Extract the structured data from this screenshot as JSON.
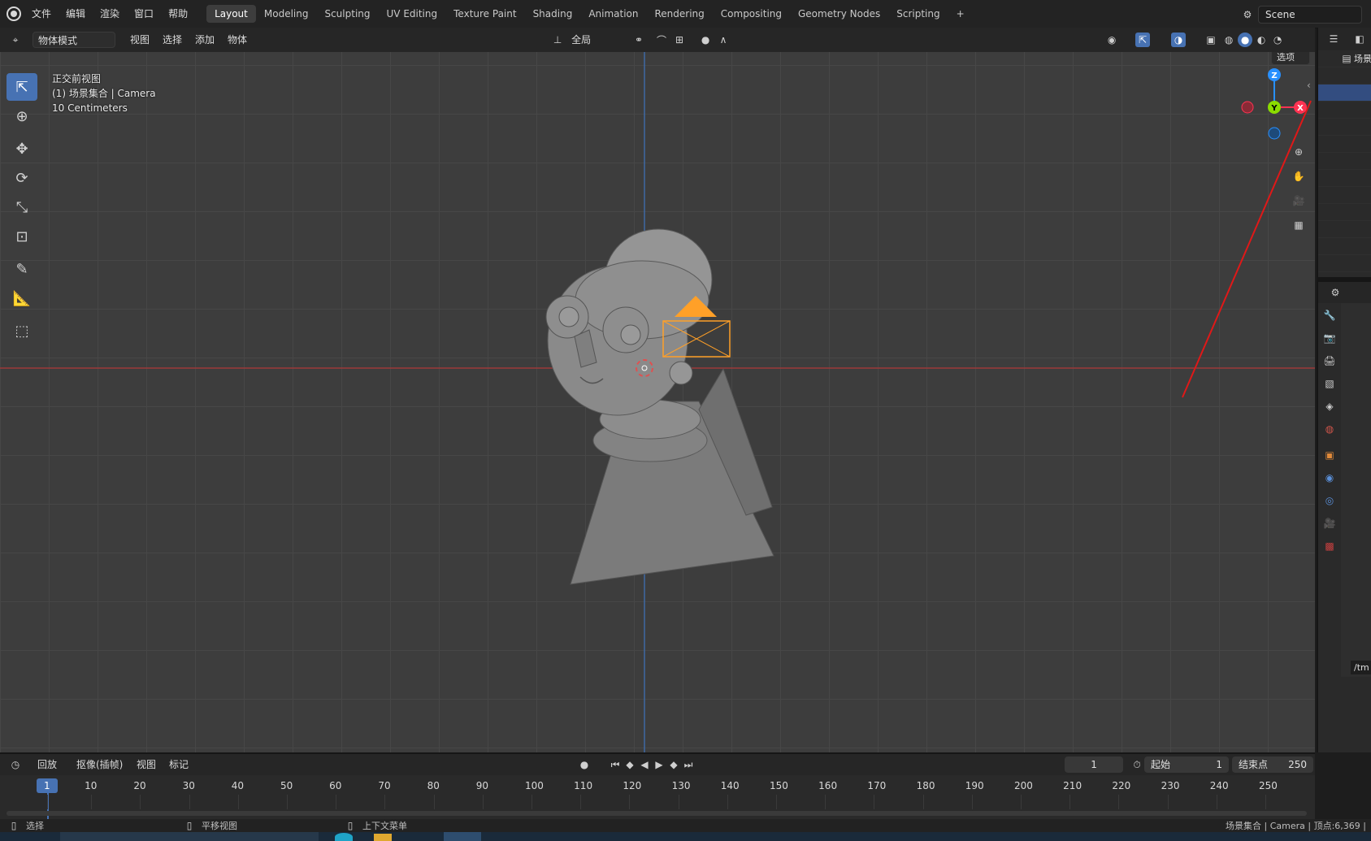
{
  "menubar": {
    "items": [
      "文件",
      "编辑",
      "渲染",
      "窗口",
      "帮助"
    ],
    "workspaces": [
      "Layout",
      "Modeling",
      "Sculpting",
      "UV Editing",
      "Texture Paint",
      "Shading",
      "Animation",
      "Rendering",
      "Compositing",
      "Geometry Nodes",
      "Scripting"
    ],
    "active_workspace": "Layout",
    "add_tab": "+",
    "scene_name": "Scene"
  },
  "viewport_header": {
    "mode": "物体模式",
    "menus": [
      "视图",
      "选择",
      "添加",
      "物体"
    ],
    "transform_orientation": "全局",
    "options": "选项"
  },
  "viewport": {
    "view_name": "正交前视图",
    "collection_info": "(1) 场景集合 | Camera",
    "scale_info": "10 Centimeters",
    "gizmo_axes": {
      "z": "Z",
      "y": "Y",
      "x": "X"
    }
  },
  "outliner": {
    "header_label": "场景"
  },
  "timeline": {
    "menus": [
      "回放",
      "抠像(插帧)",
      "视图",
      "标记"
    ],
    "current_frame": "1",
    "start_label": "起始",
    "start_value": "1",
    "end_label": "结束点",
    "end_value": "250",
    "ruler": [
      "1",
      "10",
      "20",
      "30",
      "40",
      "50",
      "60",
      "70",
      "80",
      "90",
      "100",
      "110",
      "120",
      "130",
      "140",
      "150",
      "160",
      "170",
      "180",
      "190",
      "200",
      "210",
      "220",
      "230",
      "240",
      "250"
    ]
  },
  "statusbar": {
    "select": "选择",
    "pan": "平移视图",
    "context_menu": "上下文菜单",
    "info": "场景集合 | Camera | 顶点:6,369 |"
  },
  "properties": {
    "path_field": "/tm"
  },
  "colors": {
    "accent": "#4772b3",
    "x_axis": "#ff3352",
    "y_axis": "#8bdc00",
    "z_axis": "#2890ff",
    "camera": "#ffa028"
  }
}
